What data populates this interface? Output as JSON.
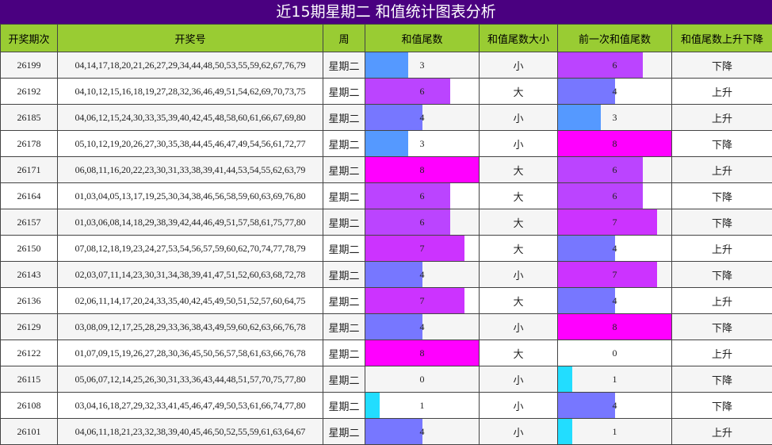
{
  "title": "近15期星期二 和值统计图表分析",
  "headers": [
    "开奖期次",
    "开奖号",
    "周",
    "和值尾数",
    "和值尾数大小",
    "前一次和值尾数",
    "和值尾数上升下降"
  ],
  "chart_data": {
    "type": "table",
    "bar_max": 8,
    "colors": {
      "0": "#ffffff",
      "1": "#22ddff",
      "3": "#5599ff",
      "4": "#7777ff",
      "6": "#bb44ff",
      "7": "#cc33ff",
      "8": "#ff00ff"
    },
    "rows": [
      {
        "issue": "26199",
        "numbers": "04,14,17,18,20,21,26,27,29,34,44,48,50,53,55,59,62,67,76,79",
        "week": "星期二",
        "tail": 3,
        "size": "小",
        "prev_tail": 6,
        "trend": "下降"
      },
      {
        "issue": "26192",
        "numbers": "04,10,12,15,16,18,19,27,28,32,36,46,49,51,54,62,69,70,73,75",
        "week": "星期二",
        "tail": 6,
        "size": "大",
        "prev_tail": 4,
        "trend": "上升"
      },
      {
        "issue": "26185",
        "numbers": "04,06,12,15,24,30,33,35,39,40,42,45,48,58,60,61,66,67,69,80",
        "week": "星期二",
        "tail": 4,
        "size": "小",
        "prev_tail": 3,
        "trend": "上升"
      },
      {
        "issue": "26178",
        "numbers": "05,10,12,19,20,26,27,30,35,38,44,45,46,47,49,54,56,61,72,77",
        "week": "星期二",
        "tail": 3,
        "size": "小",
        "prev_tail": 8,
        "trend": "下降"
      },
      {
        "issue": "26171",
        "numbers": "06,08,11,16,20,22,23,30,31,33,38,39,41,44,53,54,55,62,63,79",
        "week": "星期二",
        "tail": 8,
        "size": "大",
        "prev_tail": 6,
        "trend": "上升"
      },
      {
        "issue": "26164",
        "numbers": "01,03,04,05,13,17,19,25,30,34,38,46,56,58,59,60,63,69,76,80",
        "week": "星期二",
        "tail": 6,
        "size": "大",
        "prev_tail": 6,
        "trend": "下降"
      },
      {
        "issue": "26157",
        "numbers": "01,03,06,08,14,18,29,38,39,42,44,46,49,51,57,58,61,75,77,80",
        "week": "星期二",
        "tail": 6,
        "size": "大",
        "prev_tail": 7,
        "trend": "下降"
      },
      {
        "issue": "26150",
        "numbers": "07,08,12,18,19,23,24,27,53,54,56,57,59,60,62,70,74,77,78,79",
        "week": "星期二",
        "tail": 7,
        "size": "大",
        "prev_tail": 4,
        "trend": "上升"
      },
      {
        "issue": "26143",
        "numbers": "02,03,07,11,14,23,30,31,34,38,39,41,47,51,52,60,63,68,72,78",
        "week": "星期二",
        "tail": 4,
        "size": "小",
        "prev_tail": 7,
        "trend": "下降"
      },
      {
        "issue": "26136",
        "numbers": "02,06,11,14,17,20,24,33,35,40,42,45,49,50,51,52,57,60,64,75",
        "week": "星期二",
        "tail": 7,
        "size": "大",
        "prev_tail": 4,
        "trend": "上升"
      },
      {
        "issue": "26129",
        "numbers": "03,08,09,12,17,25,28,29,33,36,38,43,49,59,60,62,63,66,76,78",
        "week": "星期二",
        "tail": 4,
        "size": "小",
        "prev_tail": 8,
        "trend": "下降"
      },
      {
        "issue": "26122",
        "numbers": "01,07,09,15,19,26,27,28,30,36,45,50,56,57,58,61,63,66,76,78",
        "week": "星期二",
        "tail": 8,
        "size": "大",
        "prev_tail": 0,
        "trend": "上升"
      },
      {
        "issue": "26115",
        "numbers": "05,06,07,12,14,25,26,30,31,33,36,43,44,48,51,57,70,75,77,80",
        "week": "星期二",
        "tail": 0,
        "size": "小",
        "prev_tail": 1,
        "trend": "下降"
      },
      {
        "issue": "26108",
        "numbers": "03,04,16,18,27,29,32,33,41,45,46,47,49,50,53,61,66,74,77,80",
        "week": "星期二",
        "tail": 1,
        "size": "小",
        "prev_tail": 4,
        "trend": "下降"
      },
      {
        "issue": "26101",
        "numbers": "04,06,11,18,21,23,32,38,39,40,45,46,50,52,55,59,61,63,64,67",
        "week": "星期二",
        "tail": 4,
        "size": "小",
        "prev_tail": 1,
        "trend": "上升"
      }
    ]
  }
}
